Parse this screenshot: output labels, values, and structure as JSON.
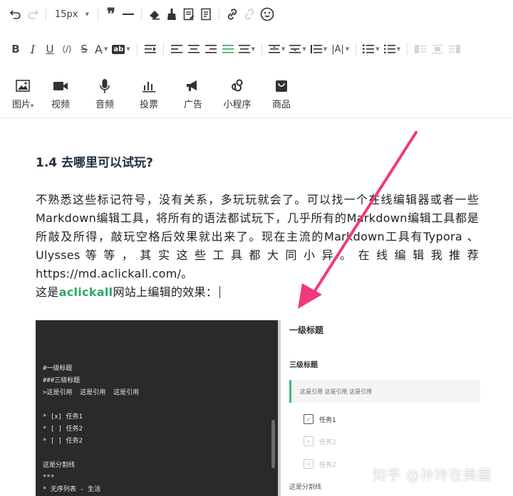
{
  "toolbar": {
    "font_size": "15px",
    "media_buttons": [
      {
        "id": "image",
        "label": "图片",
        "icon": "image-icon"
      },
      {
        "id": "video",
        "label": "视频",
        "icon": "video-icon"
      },
      {
        "id": "audio",
        "label": "音频",
        "icon": "microphone-icon"
      },
      {
        "id": "vote",
        "label": "投票",
        "icon": "bar-chart-icon"
      },
      {
        "id": "ad",
        "label": "广告",
        "icon": "megaphone-icon"
      },
      {
        "id": "mini",
        "label": "小程序",
        "icon": "mini-program-icon"
      },
      {
        "id": "shop",
        "label": "商品",
        "icon": "shopping-bag-icon"
      }
    ]
  },
  "article": {
    "heading": "1.4 去哪里可以试玩?",
    "paragraph": "不熟悉这些标记符号，没有关系，多玩玩就会了。可以找一个在线编辑器或者一些Markdown编辑工具，将所有的语法都试玩下，几乎所有的Markdown编辑工具都是所敲及所得，敲玩空格后效果就出来了。现在主流的Markdown工具有Typora 、 Ulysses 等 等 ， 其 实 这 些 工 具 都 大 同 小 异 。 在 线 编 辑 我 推 荐 https://md.aclickall.com/。",
    "line_prefix": "这是",
    "line_highlight": "aclickall",
    "line_suffix": "网站上编辑的效果："
  },
  "editor_code": [
    "#一级标题",
    "###三级标题",
    ">这是引用  这是引用  这是引用",
    "",
    "* [x] 任务1",
    "* [ ] 任务2",
    "* [ ] 任务2",
    "",
    "这是分割线",
    "***",
    "* 无序列表 - 生活"
  ],
  "preview": {
    "h1": "一级标题",
    "h3": "三级标题",
    "quote": "这是引用  这是引用  这是引用",
    "task1": "任务1",
    "task2": "任务2",
    "task3": "任务2",
    "hr": "这是分割线"
  },
  "watermark": "知乎 @孙玲在美国",
  "colors": {
    "accent_green": "#2bab63",
    "arrow": "#f2397c",
    "editor_bg": "#2a2a2a"
  }
}
